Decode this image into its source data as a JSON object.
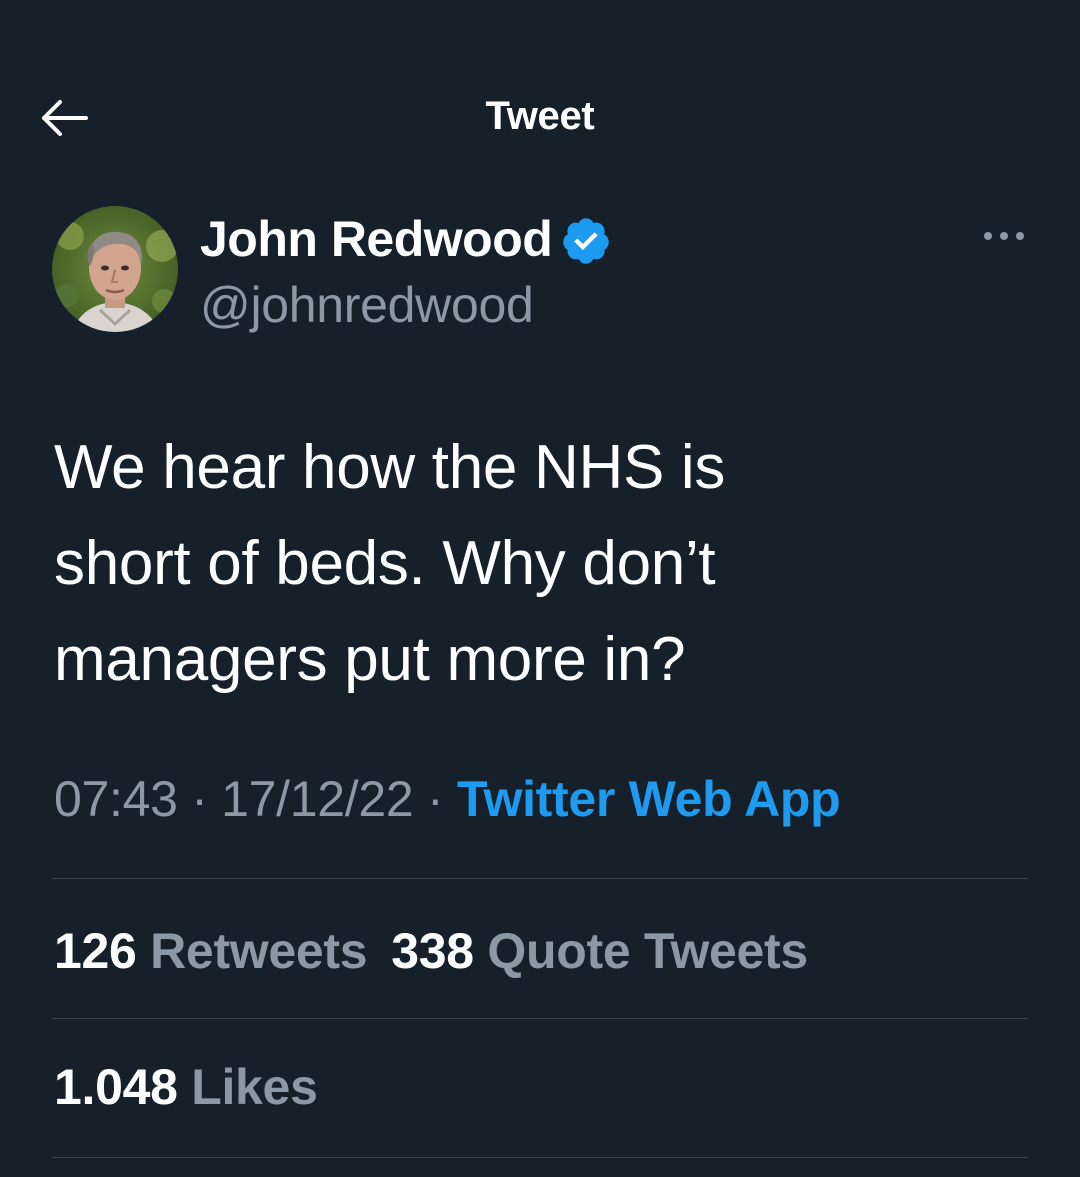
{
  "header": {
    "title": "Tweet",
    "back_icon": "arrow-left-icon"
  },
  "tweet": {
    "author": {
      "display_name": "John Redwood",
      "handle": "@johnredwood",
      "verified": true,
      "verified_icon": "verified-badge-icon",
      "verified_color": "#1d9bf0"
    },
    "more_icon": "more-horizontal-icon",
    "text": "We hear how the NHS is\nshort of beds. Why don’t\nmanagers put more in?",
    "time": "07:43",
    "date": "17/12/22",
    "separator": "·",
    "source": "Twitter Web App"
  },
  "stats": {
    "retweets_count": "126",
    "retweets_label": "Retweets",
    "quotes_count": "338",
    "quotes_label": "Quote Tweets",
    "likes_count": "1.048",
    "likes_label": "Likes"
  },
  "colors": {
    "background": "#15202b",
    "text": "#ffffff",
    "secondary_text": "#8b98a5",
    "accent": "#1d9bf0",
    "divider": "#38444d"
  }
}
